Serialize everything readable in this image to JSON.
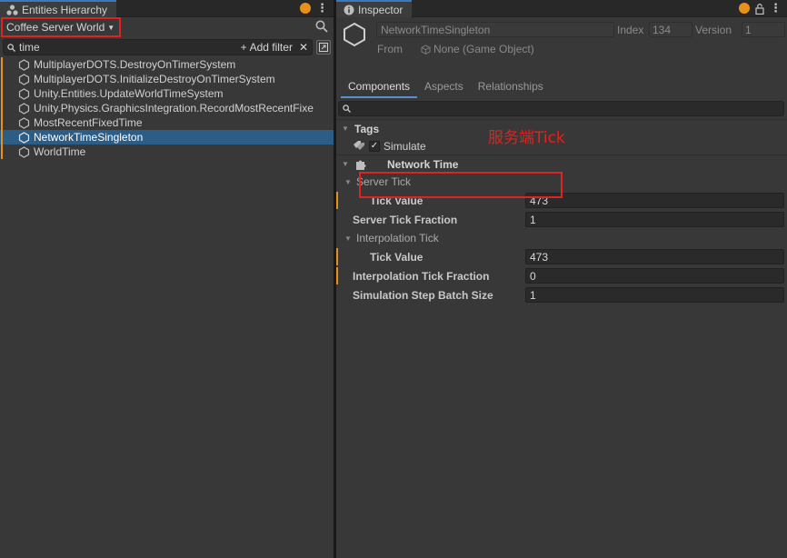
{
  "left_panel": {
    "tab_title": "Entities Hierarchy",
    "world_selector": "Coffee Server World",
    "filter": {
      "value": "time",
      "add_filter_label": "Add filter"
    },
    "items": [
      {
        "label": "MultiplayerDOTS.DestroyOnTimerSystem",
        "selected": false
      },
      {
        "label": "MultiplayerDOTS.InitializeDestroyOnTimerSystem",
        "selected": false
      },
      {
        "label": "Unity.Entities.UpdateWorldTimeSystem",
        "selected": false
      },
      {
        "label": "Unity.Physics.GraphicsIntegration.RecordMostRecentFixe",
        "selected": false
      },
      {
        "label": "MostRecentFixedTime",
        "selected": false
      },
      {
        "label": "NetworkTimeSingleton",
        "selected": true
      },
      {
        "label": "WorldTime",
        "selected": false
      }
    ]
  },
  "inspector": {
    "tab_title": "Inspector",
    "entity_name": "NetworkTimeSingleton",
    "index_label": "Index",
    "index_value": "134",
    "version_label": "Version",
    "version_value": "1",
    "from_label": "From",
    "from_value": "None (Game Object)",
    "tabs": [
      "Components",
      "Aspects",
      "Relationships"
    ],
    "active_tab": "Components",
    "tags_header": "Tags",
    "tag_simulate": "Simulate",
    "component_header": "Network Time",
    "server_tick_header": "Server Tick",
    "server_tick_value_label": "Tick Value",
    "server_tick_value": "473",
    "server_tick_fraction_label": "Server Tick Fraction",
    "server_tick_fraction": "1",
    "interp_tick_header": "Interpolation Tick",
    "interp_tick_value_label": "Tick Value",
    "interp_tick_value": "473",
    "interp_fraction_label": "Interpolation Tick Fraction",
    "interp_fraction": "0",
    "batch_size_label": "Simulation Step Batch Size",
    "batch_size": "1"
  },
  "annotation": {
    "text": "服务端Tick",
    "color": "#e0231f"
  },
  "colors": {
    "accent_orange": "#e8901c",
    "selection": "#2c5d87",
    "highlight_red": "#e0231f",
    "tab_blue": "#3a79bb"
  }
}
